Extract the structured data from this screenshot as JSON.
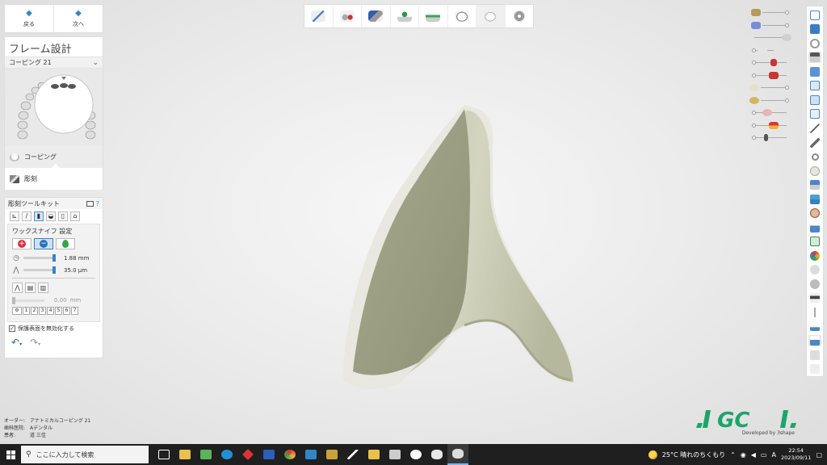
{
  "nav": {
    "back_label": "戻る",
    "next_label": "次へ"
  },
  "panel": {
    "title": "フレーム設計",
    "dropdown_value": "コーピング 21",
    "steps": [
      {
        "label": "コーピング"
      },
      {
        "label": "彫刻"
      }
    ]
  },
  "sculpt": {
    "toolkit_title": "彫刻ツールキット",
    "help": "?",
    "wax_title": "ワックスナイフ 設定",
    "radius_value": "1.88 mm",
    "thickness_value": "35.0 μm",
    "disabled_value": "0.00",
    "disabled_unit": "mm",
    "numbers": [
      "1",
      "2",
      "3",
      "4",
      "5",
      "6",
      "7"
    ],
    "checkbox_label": "保護表面を無効化する",
    "radius_fraction": 0.5,
    "thickness_fraction": 0.5
  },
  "info": {
    "order_label": "オーダー:",
    "order_value": "アナトミカルコーピング 21",
    "lab_label": "歯科医院:",
    "lab_value": "Aデンタル",
    "patient_label": "患者:",
    "patient_value": "道 三佳"
  },
  "logo": {
    "text": "GC",
    "sub": "Developed by 3shape"
  },
  "taskbar": {
    "search_placeholder": "ここに入力して検索",
    "weather": "25°C 晴れのちくもり",
    "ime": "A",
    "time": "22:54",
    "date": "2023/09/11"
  },
  "colors": {
    "accent": "#2f86c9",
    "model": "#c9cab2",
    "logo": "#1fa36a"
  }
}
